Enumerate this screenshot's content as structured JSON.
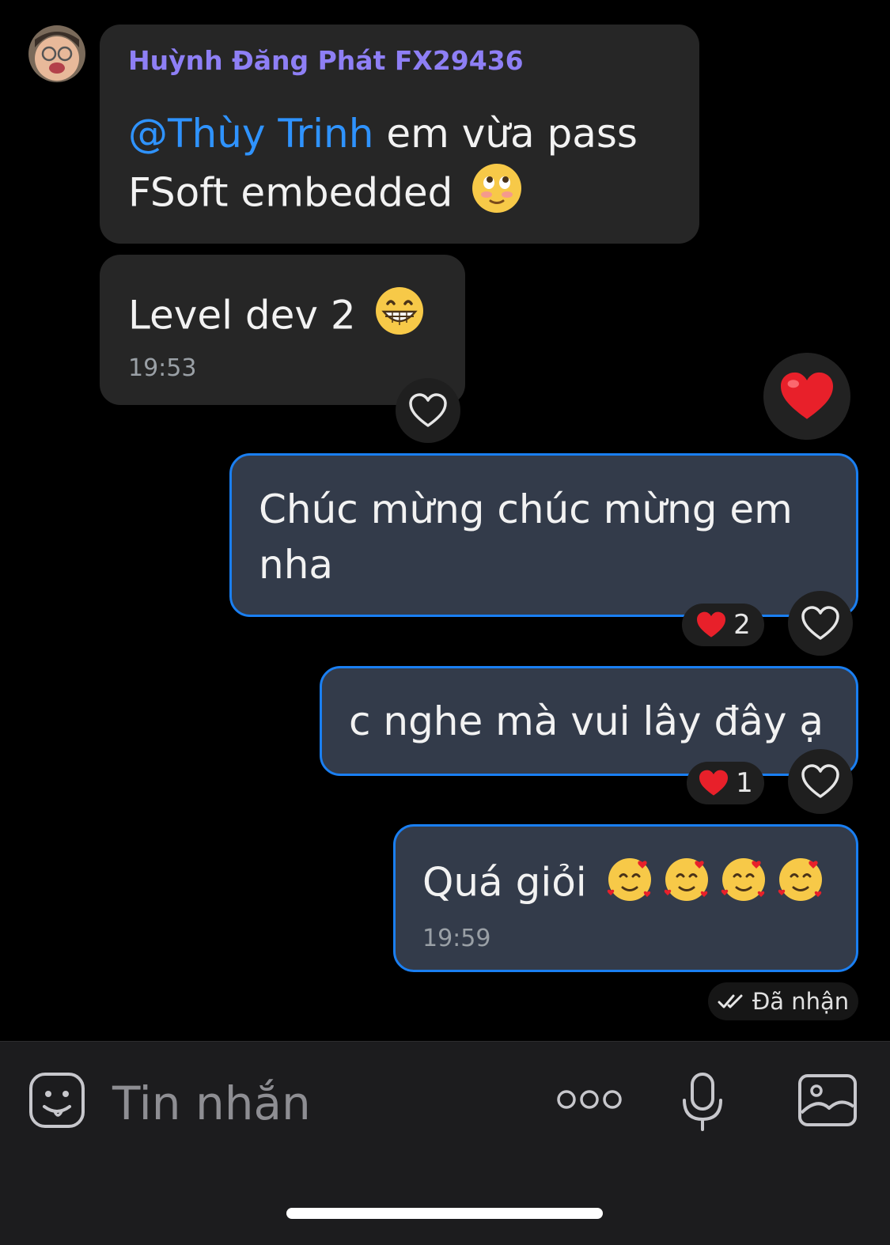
{
  "sender": {
    "name": "Huỳnh Đăng Phát FX29436"
  },
  "messages": {
    "m1": {
      "mention": "@Thùy Trinh",
      "line1_rest": " em vừa pass",
      "line2": "FSoft embedded",
      "emoji": "rolling-eyes-blush-emoji"
    },
    "m2": {
      "text": "Level dev 2",
      "emoji": "grin-emoji",
      "time": "19:53"
    },
    "m3": {
      "line1": "Chúc mừng chúc mừng em",
      "line2": "nha",
      "reactions": {
        "emoji": "red-heart",
        "count": "2"
      }
    },
    "m4": {
      "text": "c nghe mà vui lây đây ạ",
      "reactions": {
        "emoji": "red-heart",
        "count": "1"
      }
    },
    "m5": {
      "text": "Quá giỏi",
      "emoji": "smiling-face-with-hearts ×4",
      "time": "19:59"
    }
  },
  "status": {
    "label": "Đã nhận"
  },
  "composer": {
    "placeholder": "Tin nhắn"
  },
  "colors": {
    "incoming_bubble": "#262626",
    "outgoing_bubble": "#333b4a",
    "outgoing_border": "#1a7ff2",
    "sender_name": "#8e7ff5",
    "mention": "#2f93ff",
    "heart": "#e8202a"
  }
}
